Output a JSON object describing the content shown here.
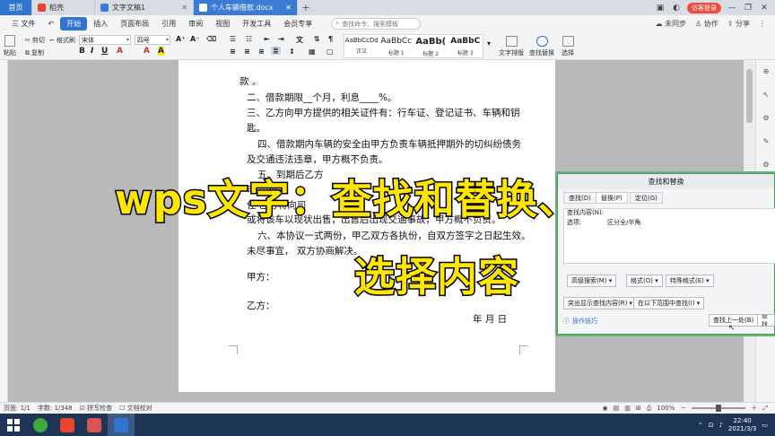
{
  "tabs": {
    "home": "首页",
    "daoke": "稻壳",
    "doc1": "文字文稿1",
    "doc2": "个人车辆借款.docx",
    "login": "访客登录"
  },
  "menu": {
    "file": "三 文件",
    "items": [
      "开始",
      "插入",
      "页面布局",
      "引用",
      "审阅",
      "视图",
      "开发工具",
      "会员专享"
    ],
    "search_placeholder": "查找命令、搜索模板",
    "right": [
      "未同步",
      "协作",
      "分享"
    ]
  },
  "ribbon": {
    "cut": "剪切",
    "format_painter": "格式刷",
    "paste": "粘贴",
    "copy": "复制",
    "font_name": "宋体",
    "font_size": "四号",
    "styles": [
      {
        "sample": "AaBbCcDd",
        "name": "正文"
      },
      {
        "sample": "AaBbCc",
        "name": "标题 1"
      },
      {
        "sample": "AaBb(",
        "name": "标题 2"
      },
      {
        "sample": "AaBbC",
        "name": "标题 3"
      }
    ],
    "text_layout": "文字排版",
    "find_replace": "查找替换",
    "select": "选择"
  },
  "document": {
    "lines": [
      "款                    。",
      "二、借款期限__个月，利息____%。",
      "三、乙方向甲方提供的相关证件有：行车证、登记证书、车辆和钥",
      "匙。",
      "四、借款期内车辆的安全由甲方负责车辆抵押期外的切纠纷债务",
      "及交通违法违章，甲方概不负责。",
      "五、到期后乙方",
      "可    由处置",
      "任    乙方将向司",
      "或将该车以现状出售，出售后出现交通事故，甲方概不负责。",
      "六、本协议一式两份，甲乙双方各执份，自双方签字之日起生效。",
      "未尽事宜，  双方协商解决。",
      "甲方：",
      "乙方：",
      "年    月    日"
    ]
  },
  "dialog": {
    "title": "查找和替换",
    "tabs": [
      "查找(D)",
      "替换(P)",
      "定位(G)"
    ],
    "search_label": "查找内容(N):",
    "options_label": "选项:",
    "options_value": "区分全/半角",
    "btn_advanced": "高级搜索(M) ▾",
    "btn_format": "格式(O) ▾",
    "btn_special": "特殊格式(E) ▾",
    "btn_highlight": "突出显示查找内容(R) ▾",
    "btn_scope": "在以下范围中查找(I) ▾",
    "tips": "操作技巧",
    "btn_prev": "查找上一处(B)",
    "btn_next": "查找"
  },
  "captions": {
    "line1": "wps文字：查找和替换、",
    "line2": "选择内容"
  },
  "status": {
    "page": "页面: 1/1",
    "words": "字数: 1/348",
    "spell": "拼写检查",
    "proof": "文档校对",
    "zoom": "100%",
    "zoom_fraction": 0.5
  },
  "taskbar": {
    "time": "22:40",
    "date": "2021/3/3"
  },
  "colors": {
    "accent": "#2f74d0",
    "caption_fill": "#ffe600",
    "dialog_border": "#4a9a5a"
  }
}
